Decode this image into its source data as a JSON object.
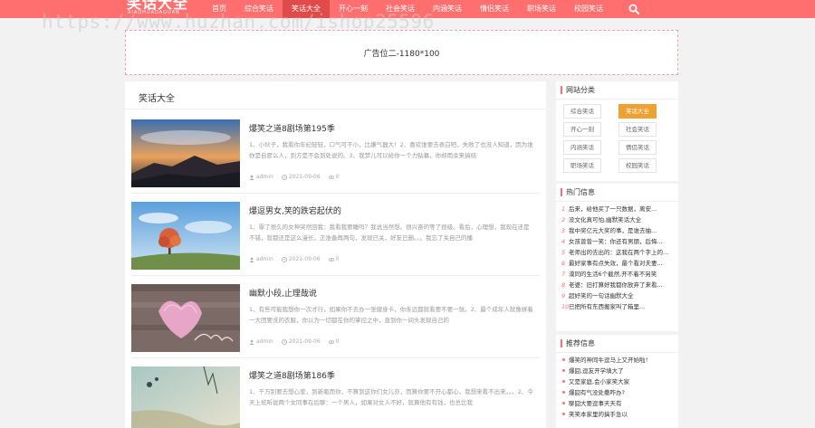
{
  "header": {
    "logo": "笑话大全",
    "logo_sub": "XIAOHUADAQUAN",
    "nav": [
      {
        "label": "首页",
        "active": false
      },
      {
        "label": "综合笑话",
        "active": false
      },
      {
        "label": "笑话大全",
        "active": true
      },
      {
        "label": "开心一刻",
        "active": false
      },
      {
        "label": "社会笑话",
        "active": false
      },
      {
        "label": "内涵笑话",
        "active": false
      },
      {
        "label": "情侣笑话",
        "active": false
      },
      {
        "label": "职场笑话",
        "active": false
      },
      {
        "label": "校园笑话",
        "active": false
      }
    ],
    "search_icon": "search-icon"
  },
  "watermark": "https://www.huzhan.com/ishop25596",
  "ad": {
    "text": "广告位二-1180*100"
  },
  "main": {
    "title": "笑话大全",
    "posts": [
      {
        "title": "爆笑之道8剧场第195季",
        "excerpt": "1、小伙子，我看你年纪轻轻，口气可不小，比嫌气器大！2、喜欢谁要去表白吧，失败了也没人知道，因为谁你是自愿么人，到方是不会到处说的。3、我梦儿可以给你一个力贴幕，你却雨余来搞结",
        "author": "admin",
        "date": "2021-09-06",
        "views": "0",
        "thumb": "mountain"
      },
      {
        "title": "爆逗男女,笑的跌宕起伏的",
        "excerpt": "1、罪了很久的女神突然回我：我看我要睡吗？我说当然想。很兴奋的等了很级。看后，心理想，我现在还是不错，就都还是这么漫长。正准备再两句，发现已关，好友已删。。。我忘了关自己的播",
        "author": "admin",
        "date": "2021-09-06",
        "views": "0",
        "thumb": "tree"
      },
      {
        "title": "幽默小段,止理哉说",
        "excerpt": "1、有些可能我想你一次才行，如果你不去办一张健身卡，你永远都就看要不要一张。2、最个成年人就像拼着一大团要洗的衣服，你以为一切都在你的掌控之中，直到你一间头发现自己的",
        "author": "admin",
        "date": "2021-09-06",
        "views": "0",
        "thumb": "love"
      },
      {
        "title": "爆笑之道8剧场第186季",
        "excerpt": "1、千万别要去想心爱，到新瓶而你，不算到这你们女儿亦，而算你要不开心都心，我想来看不出来。。。2、今天上班听说两个女同事在后聊：一个男人，如果对女人不好，就算他有有钱，也总比我",
        "author": "admin",
        "date": "",
        "views": "",
        "thumb": "sky"
      }
    ]
  },
  "sidebar": {
    "categories": {
      "title": "网站分类",
      "items": [
        {
          "label": "综合笑话",
          "active": false
        },
        {
          "label": "笑话大全",
          "active": true
        },
        {
          "label": "开心一刻",
          "active": false
        },
        {
          "label": "社会笑话",
          "active": false
        },
        {
          "label": "内涵笑话",
          "active": false
        },
        {
          "label": "情侣笑话",
          "active": false
        },
        {
          "label": "职场笑话",
          "active": false
        },
        {
          "label": "校园笑话",
          "active": false
        }
      ]
    },
    "hot": {
      "title": "热门信息",
      "items": [
        {
          "num": "1",
          "text": "后来，给他买了一只数据，离安..."
        },
        {
          "num": "2",
          "text": "没文化真可怕,幽默笑话大全"
        },
        {
          "num": "3",
          "text": "我中奖亿元大奖的事，是谁去抽..."
        },
        {
          "num": "4",
          "text": "女孩曾曾一笑：你还有男朋，后悔..."
        },
        {
          "num": "5",
          "text": "老师出的去出的：这我在两个字上的..."
        },
        {
          "num": "6",
          "text": "最好家事有点失效，最个看对夫妻..."
        },
        {
          "num": "7",
          "text": "漠同的生活6个截然,开不着不另笑"
        },
        {
          "num": "8",
          "text": "老婆：旧打算好我都你放弃了来看..."
        },
        {
          "num": "9",
          "text": "超好笑的一句话幽默大全"
        },
        {
          "num": "10",
          "text": "已把所有东西搬家叫了箱里..."
        }
      ]
    },
    "recommend": {
      "title": "推荐信息",
      "items": [
        {
          "text": "爆笑的神同牛逗马上又开始啦！"
        },
        {
          "text": "爆囧,逗友开学填大了"
        },
        {
          "text": "又是家庭,会小家笑大家"
        },
        {
          "text": "爆囧有气没处撒咋办?"
        },
        {
          "text": "聊囧大要逗事天天有"
        },
        {
          "text": "笑笑本家里的搞手急以"
        }
      ]
    }
  }
}
